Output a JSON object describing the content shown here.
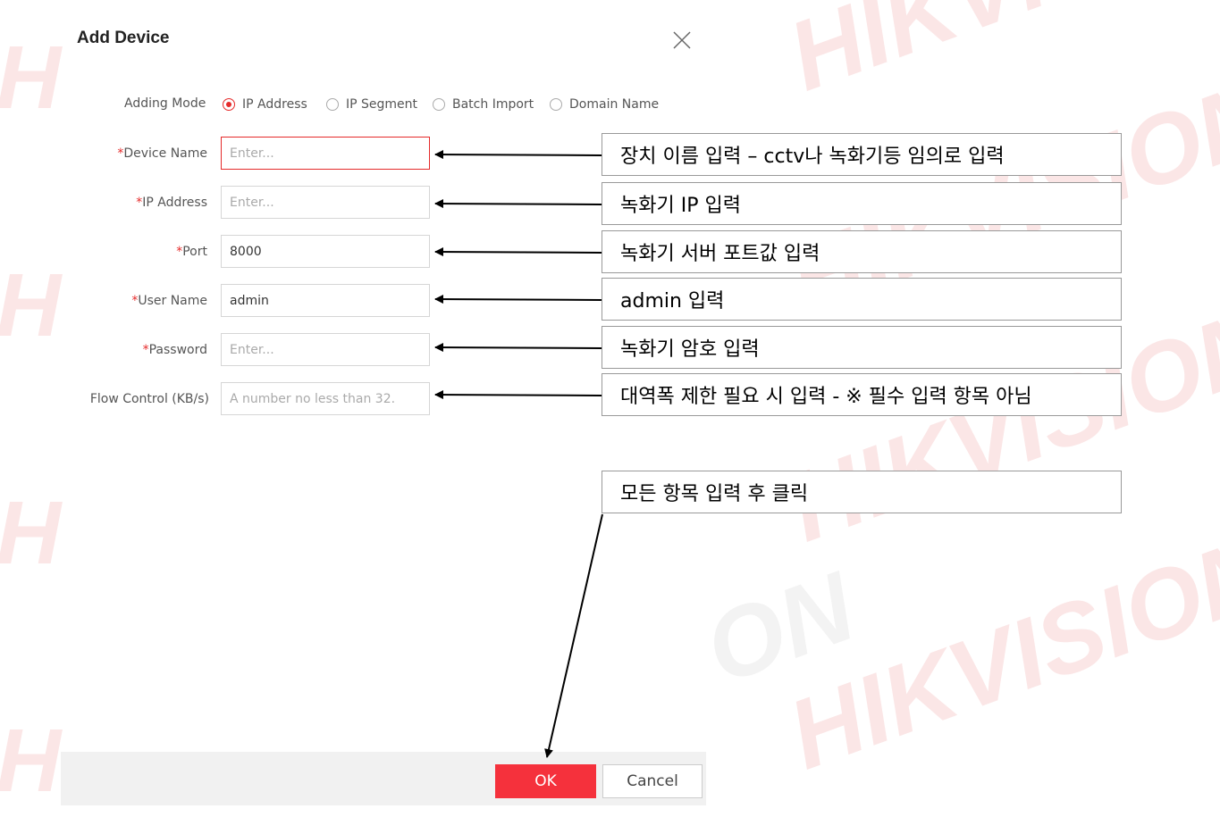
{
  "dialog": {
    "title": "Add Device"
  },
  "adding_mode": {
    "label": "Adding Mode",
    "options": [
      "IP Address",
      "IP Segment",
      "Batch Import",
      "Domain Name"
    ],
    "selected": "IP Address"
  },
  "fields": [
    {
      "label": "Device Name",
      "required": "*",
      "value": "",
      "placeholder": "Enter..."
    },
    {
      "label": "IP Address",
      "required": "*",
      "value": "",
      "placeholder": "Enter..."
    },
    {
      "label": "Port",
      "required": "*",
      "value": "8000",
      "placeholder": ""
    },
    {
      "label": "User Name",
      "required": "*",
      "value": "admin",
      "placeholder": ""
    },
    {
      "label": "Password",
      "required": "*",
      "value": "",
      "placeholder": "Enter..."
    },
    {
      "label": "Flow Control (KB/s)",
      "required": "",
      "value": "",
      "placeholder": "A number no less than 32."
    }
  ],
  "annotations": [
    "장치 이름 입력 – cctv나 녹화기등 임의로 입력",
    "녹화기 IP 입력",
    "녹화기 서버 포트값 입력",
    "admin 입력",
    "녹화기 암호 입력",
    "대역폭 제한 필요 시 입력 - ※ 필수 입력 항목 아님",
    "모든 항목 입력 후 클릭"
  ],
  "buttons": {
    "ok": "OK",
    "cancel": "Cancel"
  },
  "watermark": {
    "brand": "HIKVISION",
    "letter": "H",
    "partner": "ON"
  },
  "colors": {
    "accent": "#e52a2a",
    "ok_button": "#f5313c",
    "watermark": "#fbe6e6"
  }
}
